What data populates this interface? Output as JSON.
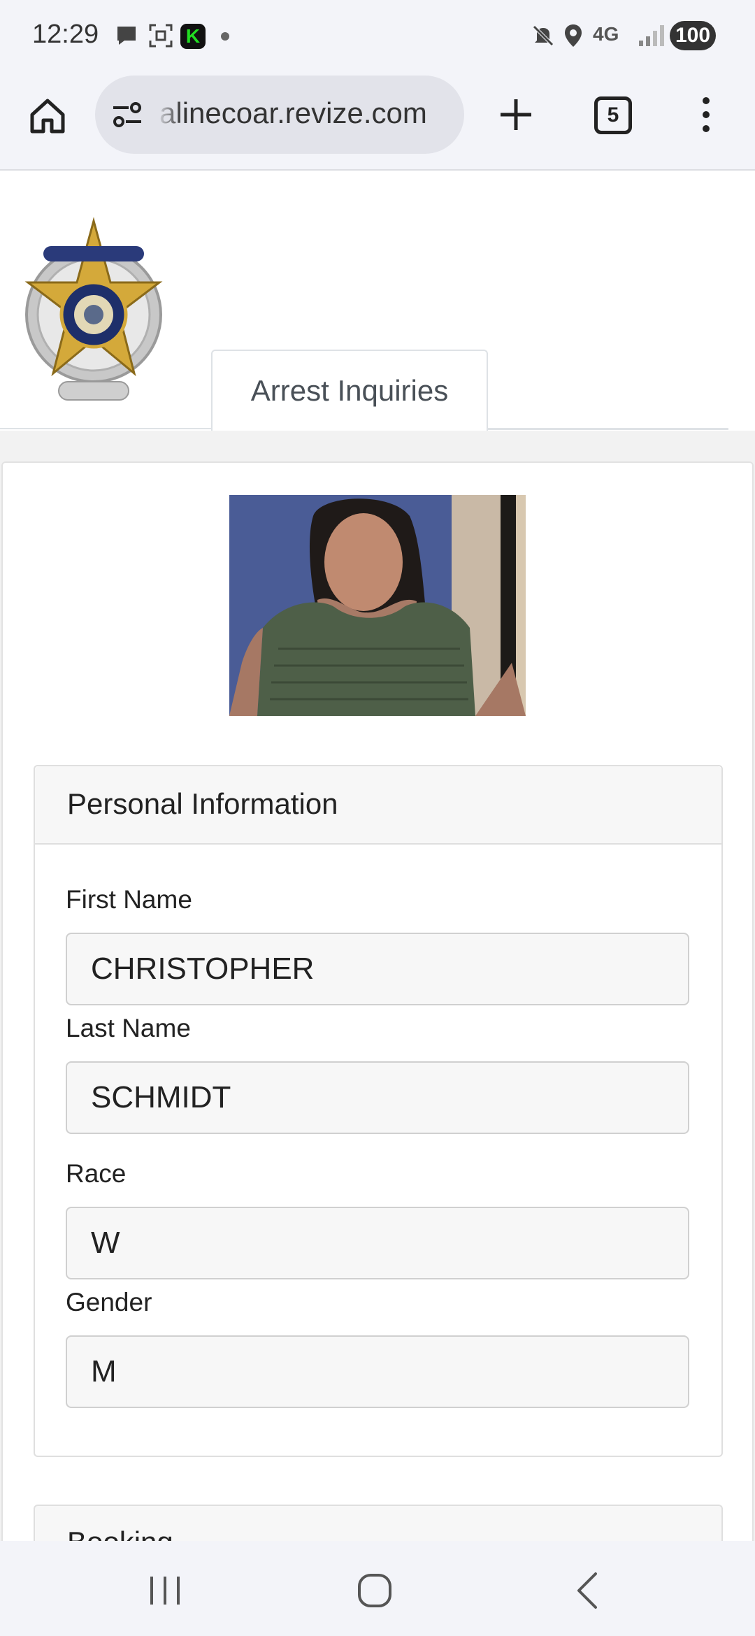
{
  "status_bar": {
    "time": "12:29",
    "network": "4G",
    "battery": "100"
  },
  "browser": {
    "url": "alinecoar.revize.com",
    "tab_count": "5"
  },
  "header": {
    "logo_alt": "Saline County Sheriff badge",
    "tab_label": "Arrest Inquiries"
  },
  "personal_info": {
    "title": "Personal Information",
    "fields": [
      {
        "label": "First Name",
        "value": "CHRISTOPHER"
      },
      {
        "label": "Last Name",
        "value": "SCHMIDT"
      },
      {
        "label": "Race",
        "value": "W"
      },
      {
        "label": "Gender",
        "value": "M"
      }
    ]
  },
  "booking": {
    "title": "Booking"
  },
  "colors": {
    "status_bg": "#f3f4f9",
    "pill_bg": "#e2e3ea",
    "field_bg": "#f7f7f7",
    "page_gray": "#f2f2f2"
  }
}
